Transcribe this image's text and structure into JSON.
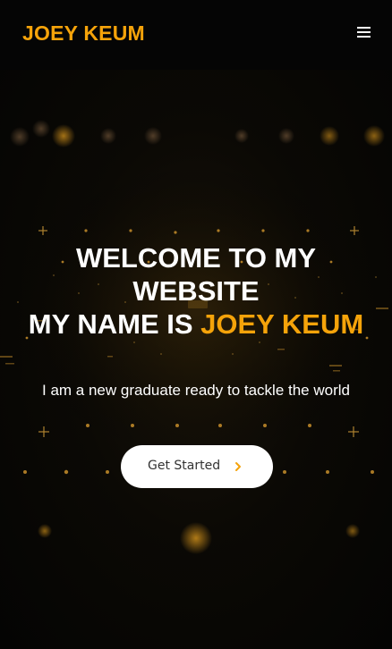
{
  "header": {
    "logo": "JOEY KEUM",
    "menu_icon": "hamburger-menu-icon"
  },
  "hero": {
    "headline_line1": "WELCOME TO MY",
    "headline_line2": "WEBSITE",
    "headline_prefix": "MY NAME IS ",
    "headline_name": "JOEY KEUM",
    "tagline": "I am a new graduate ready to tackle the world",
    "cta_label": "Get Started",
    "cta_icon": "chevron-right-icon"
  },
  "colors": {
    "accent": "#f5a30a",
    "background": "#000000",
    "text": "#ffffff",
    "button_bg": "#ffffff",
    "button_text": "#333333"
  }
}
